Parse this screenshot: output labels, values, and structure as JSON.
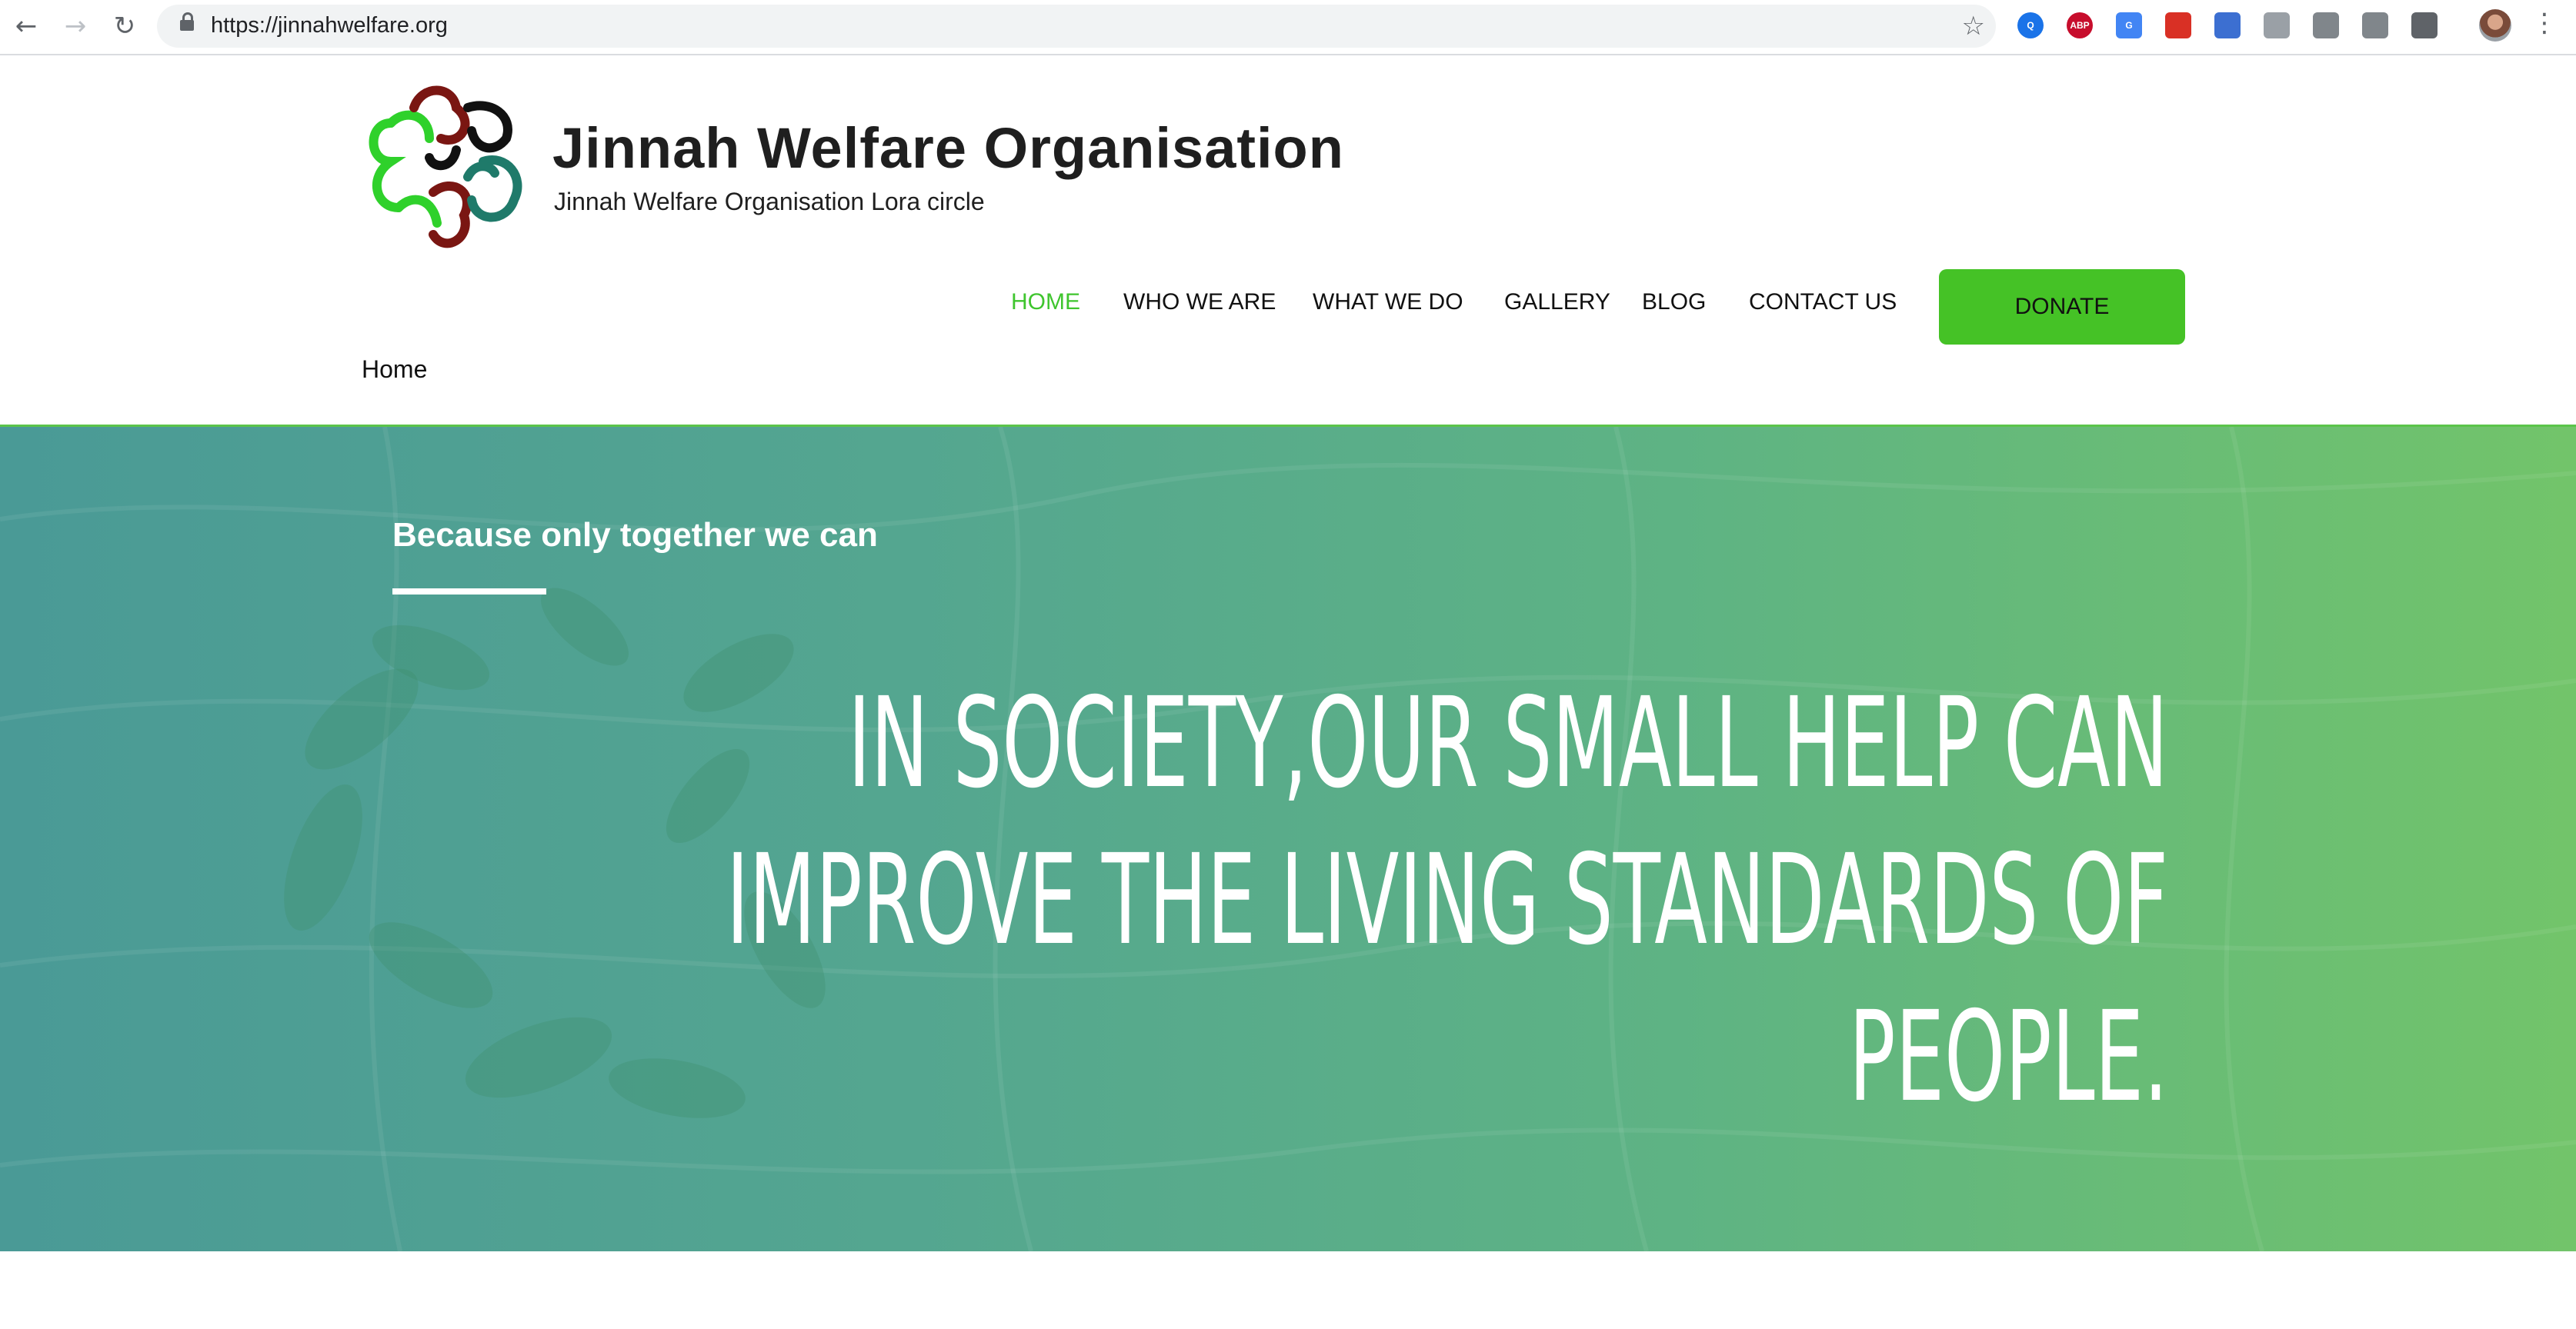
{
  "browser": {
    "url": "https://jinnahwelfare.org",
    "back_icon": "arrow-left-icon",
    "forward_icon": "arrow-right-icon",
    "reload_icon": "reload-icon",
    "bookmark_icon": "star-icon",
    "extensions": [
      {
        "name": "search-extension-icon",
        "label": "Q",
        "color": "#1a73e8"
      },
      {
        "name": "adblock-plus-icon",
        "label": "ABP",
        "color": "#c70d2c"
      },
      {
        "name": "translate-icon",
        "label": "G",
        "color": "#4285f4"
      },
      {
        "name": "bookmark-extension-icon",
        "label": "",
        "color": "#d93025"
      },
      {
        "name": "print-icon",
        "label": "",
        "color": "#3c6fd1"
      },
      {
        "name": "screen-icon",
        "label": "",
        "color": "#9aa0a6"
      },
      {
        "name": "drive-icon",
        "label": "",
        "color": "#80868b"
      },
      {
        "name": "text-extension-icon",
        "label": "",
        "color": "#80868b"
      },
      {
        "name": "move-icon",
        "label": "",
        "color": "#5f6368"
      }
    ]
  },
  "site": {
    "title": "Jinnah Welfare Organisation",
    "tagline": "Jinnah Welfare Organisation Lora circle",
    "breadcrumb": "Home"
  },
  "nav": {
    "items": [
      {
        "label": "HOME",
        "active": true
      },
      {
        "label": "WHO WE ARE",
        "active": false
      },
      {
        "label": "WHAT WE DO",
        "active": false
      },
      {
        "label": "GALLERY",
        "active": false
      },
      {
        "label": "BLOG",
        "active": false
      },
      {
        "label": "CONTACT US",
        "active": false
      }
    ],
    "donate_label": "DONATE"
  },
  "hero": {
    "kicker": "Because only together we can",
    "headline": "In society,Our small help can improve the living standards of people."
  },
  "colors": {
    "accent_green": "#45c226",
    "nav_active": "#3fc52e",
    "hero_left": "#4a9a96",
    "hero_right": "#72c46a"
  }
}
